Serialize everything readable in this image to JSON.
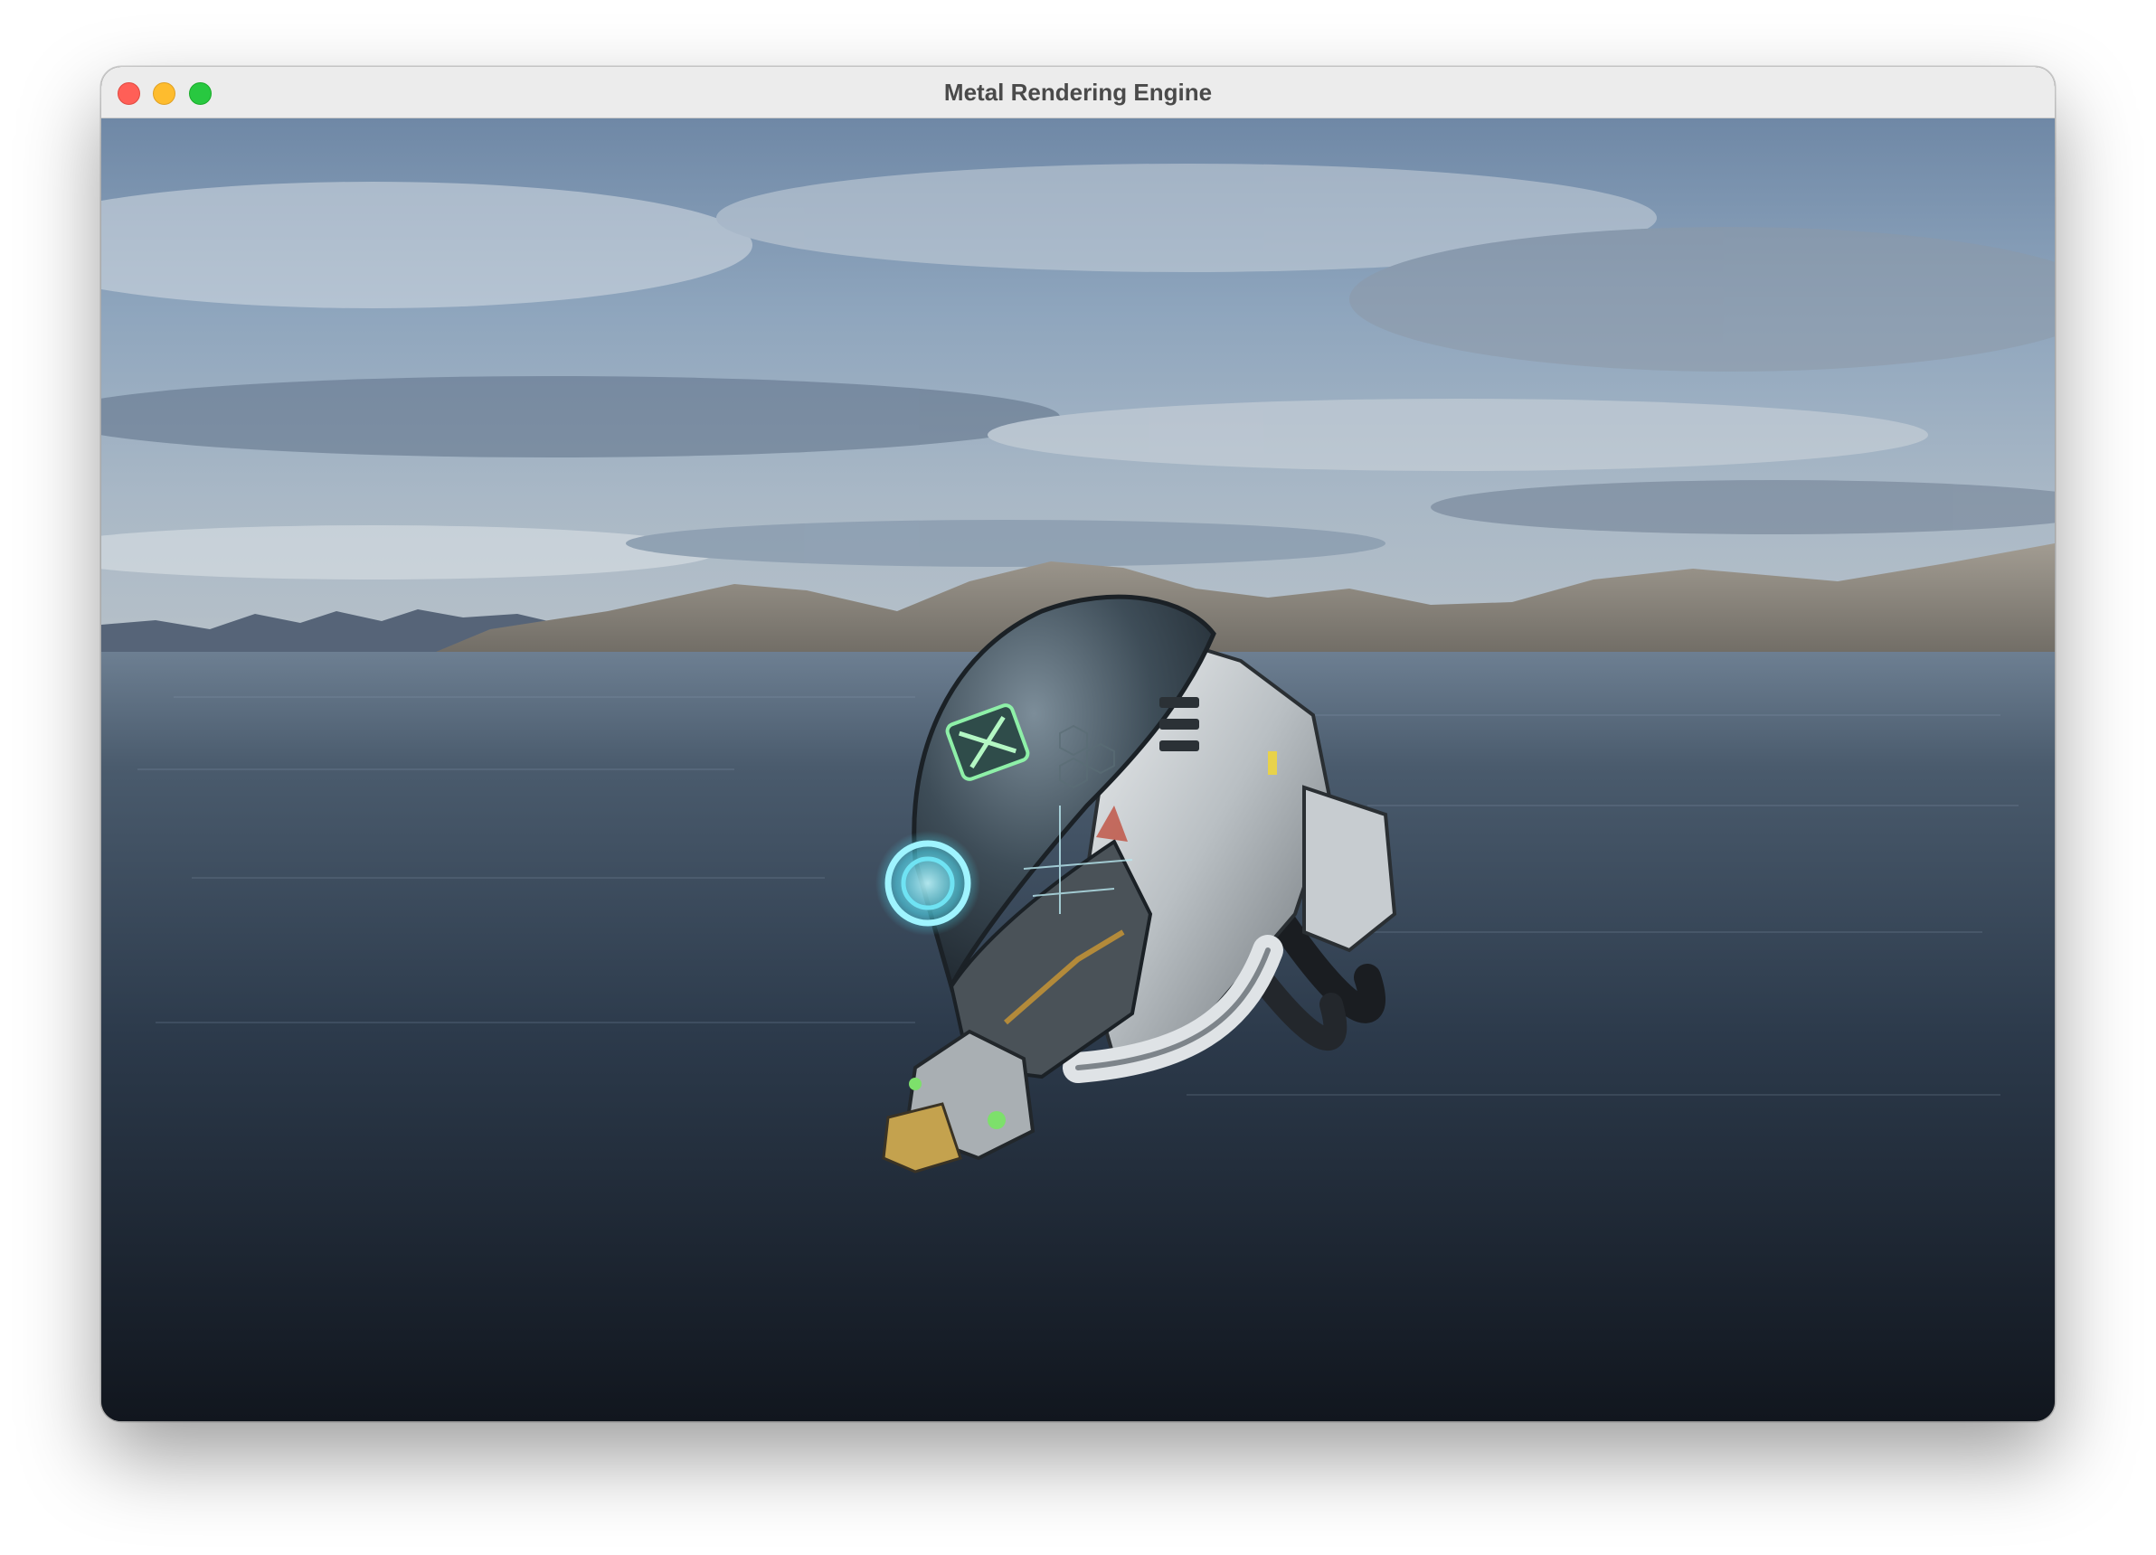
{
  "window": {
    "title": "Metal Rendering Engine",
    "controls": [
      "close",
      "minimize",
      "zoom"
    ],
    "colors": {
      "close": "#ff5f57",
      "minimize": "#febc2e",
      "zoom": "#28c840"
    }
  },
  "viewport": {
    "scene": [
      "sky-with-clouds",
      "mountain-range",
      "water",
      "sci-fi-helmet-model"
    ]
  }
}
